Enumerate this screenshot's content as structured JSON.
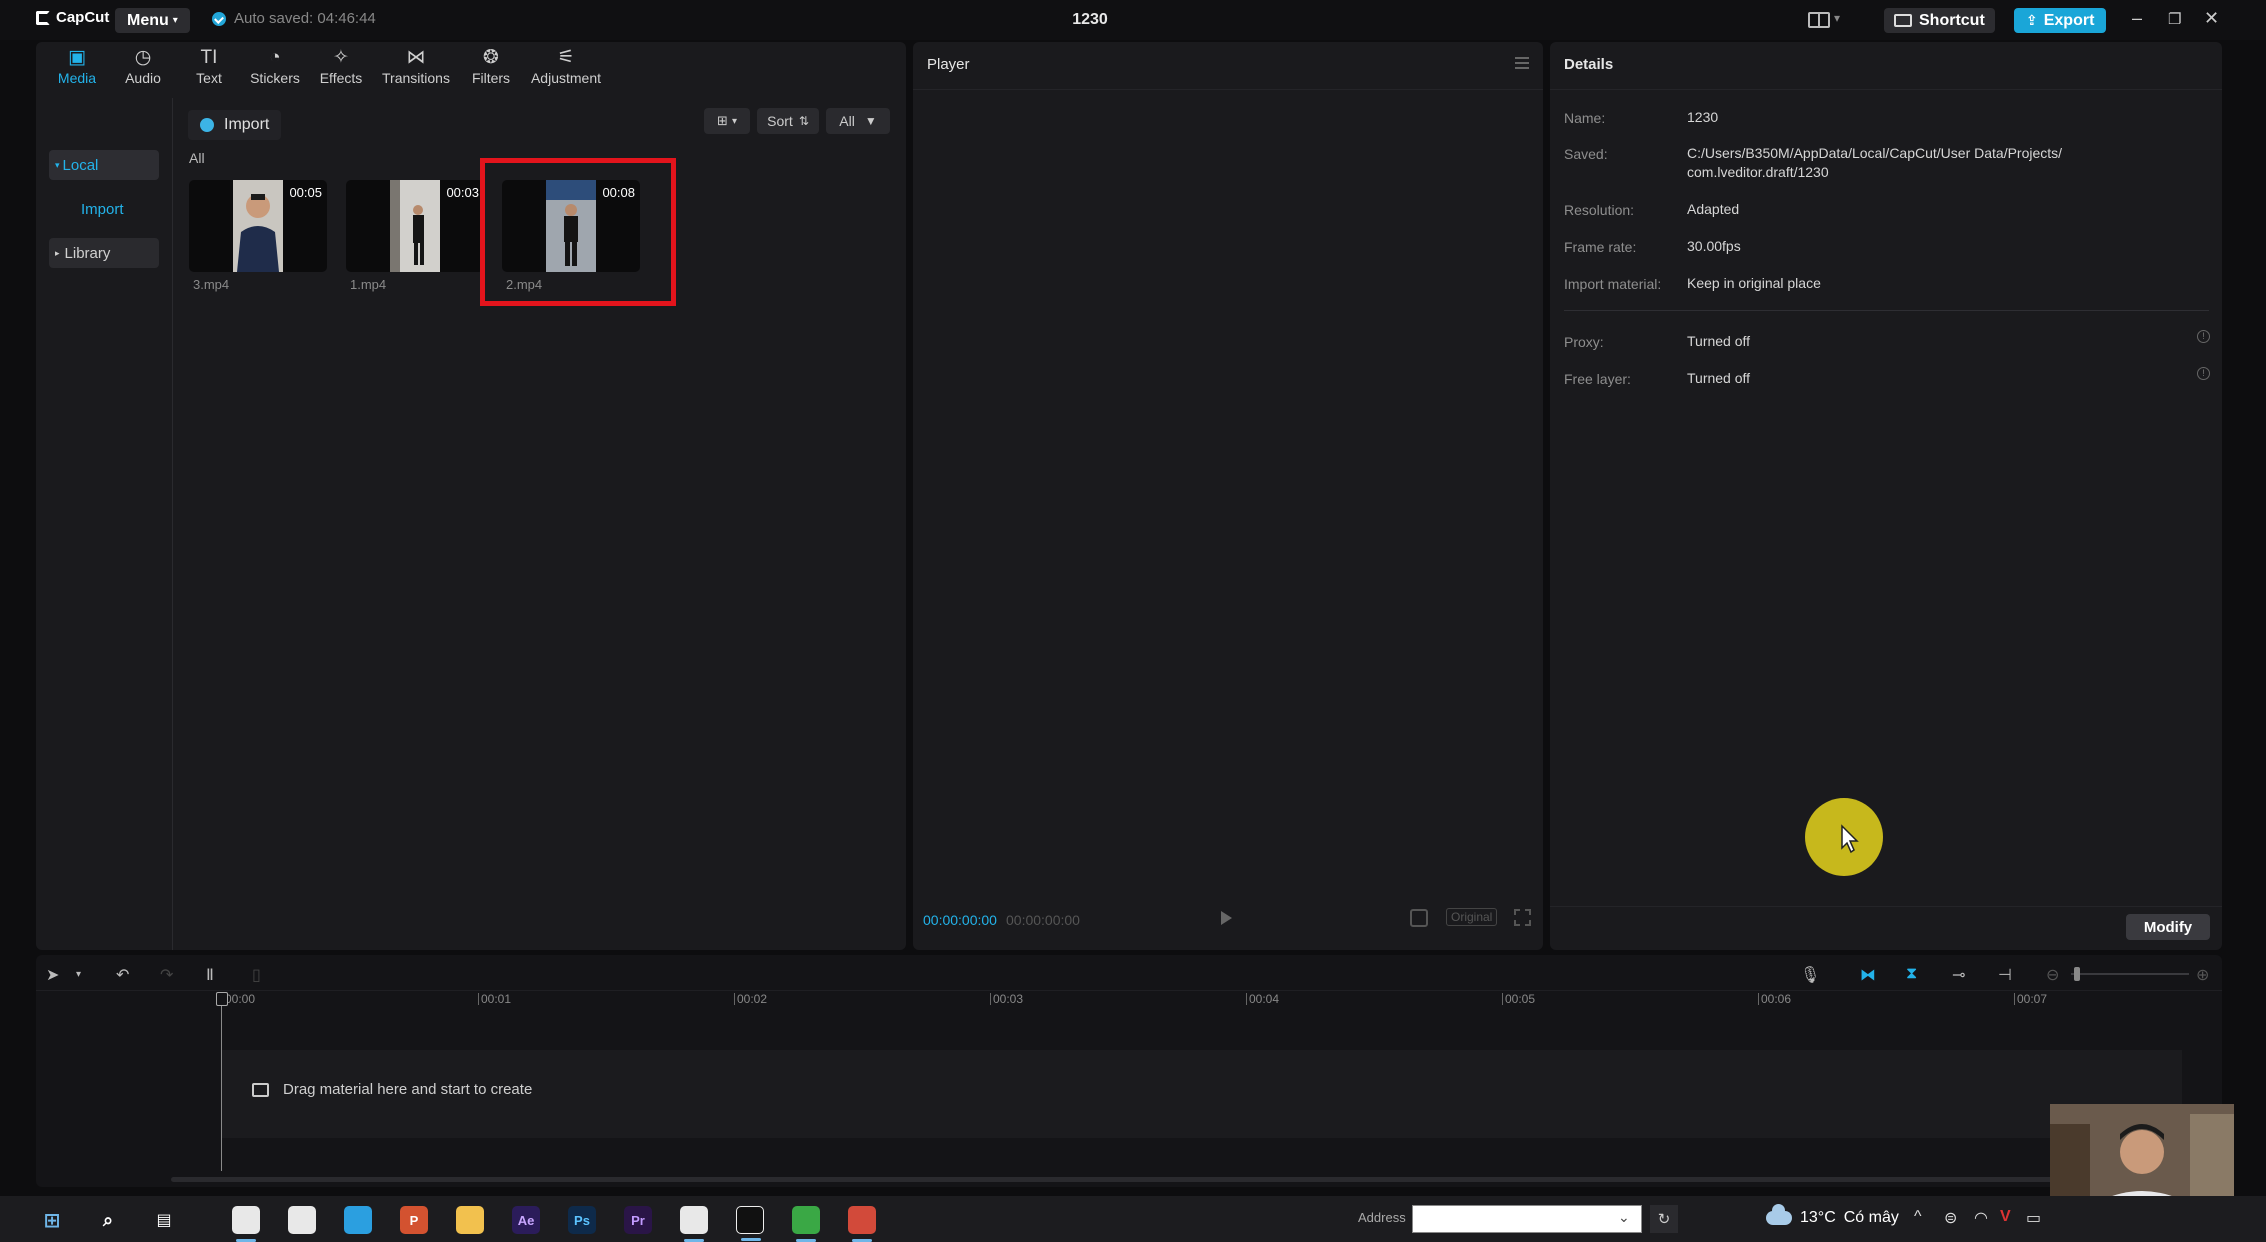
{
  "titlebar": {
    "app_name": "CapCut",
    "menu_label": "Menu",
    "autosave_text": "Auto saved: 04:46:44",
    "project_title": "1230",
    "shortcut_label": "Shortcut",
    "export_label": "Export",
    "accent_color": "#1aa6d8"
  },
  "media": {
    "tabs": [
      {
        "label": "Media",
        "icon": "media-icon",
        "active": true
      },
      {
        "label": "Audio",
        "icon": "audio-icon"
      },
      {
        "label": "Text",
        "icon": "text-icon"
      },
      {
        "label": "Stickers",
        "icon": "sticker-icon"
      },
      {
        "label": "Effects",
        "icon": "effects-icon"
      },
      {
        "label": "Transitions",
        "icon": "transitions-icon"
      },
      {
        "label": "Filters",
        "icon": "filters-icon"
      },
      {
        "label": "Adjustment",
        "icon": "adjustment-icon"
      }
    ],
    "sidebar": {
      "local": "Local",
      "import": "Import",
      "library": "Library"
    },
    "import_label": "Import",
    "sort_label": "Sort",
    "all_filter_label": "All",
    "section_label": "All",
    "clips": [
      {
        "name": "3.mp4",
        "duration": "00:05"
      },
      {
        "name": "1.mp4",
        "duration": "00:03"
      },
      {
        "name": "2.mp4",
        "duration": "00:08",
        "selected": true
      }
    ]
  },
  "player": {
    "title": "Player",
    "current_time": "00:00:00:00",
    "total_time": "00:00:00:00",
    "ratio_label": "Original"
  },
  "details": {
    "title": "Details",
    "rows": [
      {
        "label": "Name:",
        "value": "1230"
      },
      {
        "label": "Saved:",
        "value": "C:/Users/B350M/AppData/Local/CapCut/User Data/Projects/\ncom.lveditor.draft/1230"
      },
      {
        "label": "Resolution:",
        "value": "Adapted"
      },
      {
        "label": "Frame rate:",
        "value": "30.00fps"
      },
      {
        "label": "Import material:",
        "value": "Keep in original place"
      },
      {
        "label": "Proxy:",
        "value": "Turned off"
      },
      {
        "label": "Free layer:",
        "value": "Turned off"
      }
    ],
    "modify_label": "Modify"
  },
  "timeline": {
    "ticks": [
      "00:00",
      "00:01",
      "00:02",
      "00:03",
      "00:04",
      "00:05",
      "00:06",
      "00:07"
    ],
    "drag_hint": "Drag material here and start to create"
  },
  "taskbar": {
    "address_label": "Address",
    "weather_temp": "13°C",
    "weather_text": "Có mây",
    "apps": [
      {
        "label": "",
        "icon": "chrome-icon",
        "color": "#e8e8e8"
      },
      {
        "label": "",
        "icon": "chrome-icon",
        "color": "#e8e8e8"
      },
      {
        "label": "",
        "icon": "edge-icon",
        "color": "#2b9fe0"
      },
      {
        "label": "P",
        "icon": "powerpoint-icon",
        "color": "#d35230"
      },
      {
        "label": "",
        "icon": "folder-icon",
        "color": "#f2c14e"
      },
      {
        "label": "Ae",
        "icon": "after-effects-icon",
        "color": "#2b1c5a"
      },
      {
        "label": "Ps",
        "icon": "photoshop-icon",
        "color": "#0e2a4a"
      },
      {
        "label": "Pr",
        "icon": "premiere-icon",
        "color": "#2a1547"
      },
      {
        "label": "",
        "icon": "chrome-icon",
        "color": "#e8e8e8"
      },
      {
        "label": "",
        "icon": "capcut-icon",
        "color": "#111111"
      },
      {
        "label": "",
        "icon": "green-app-icon",
        "color": "#3aa845"
      },
      {
        "label": "",
        "icon": "red-app-icon",
        "color": "#d24a3a"
      }
    ]
  }
}
